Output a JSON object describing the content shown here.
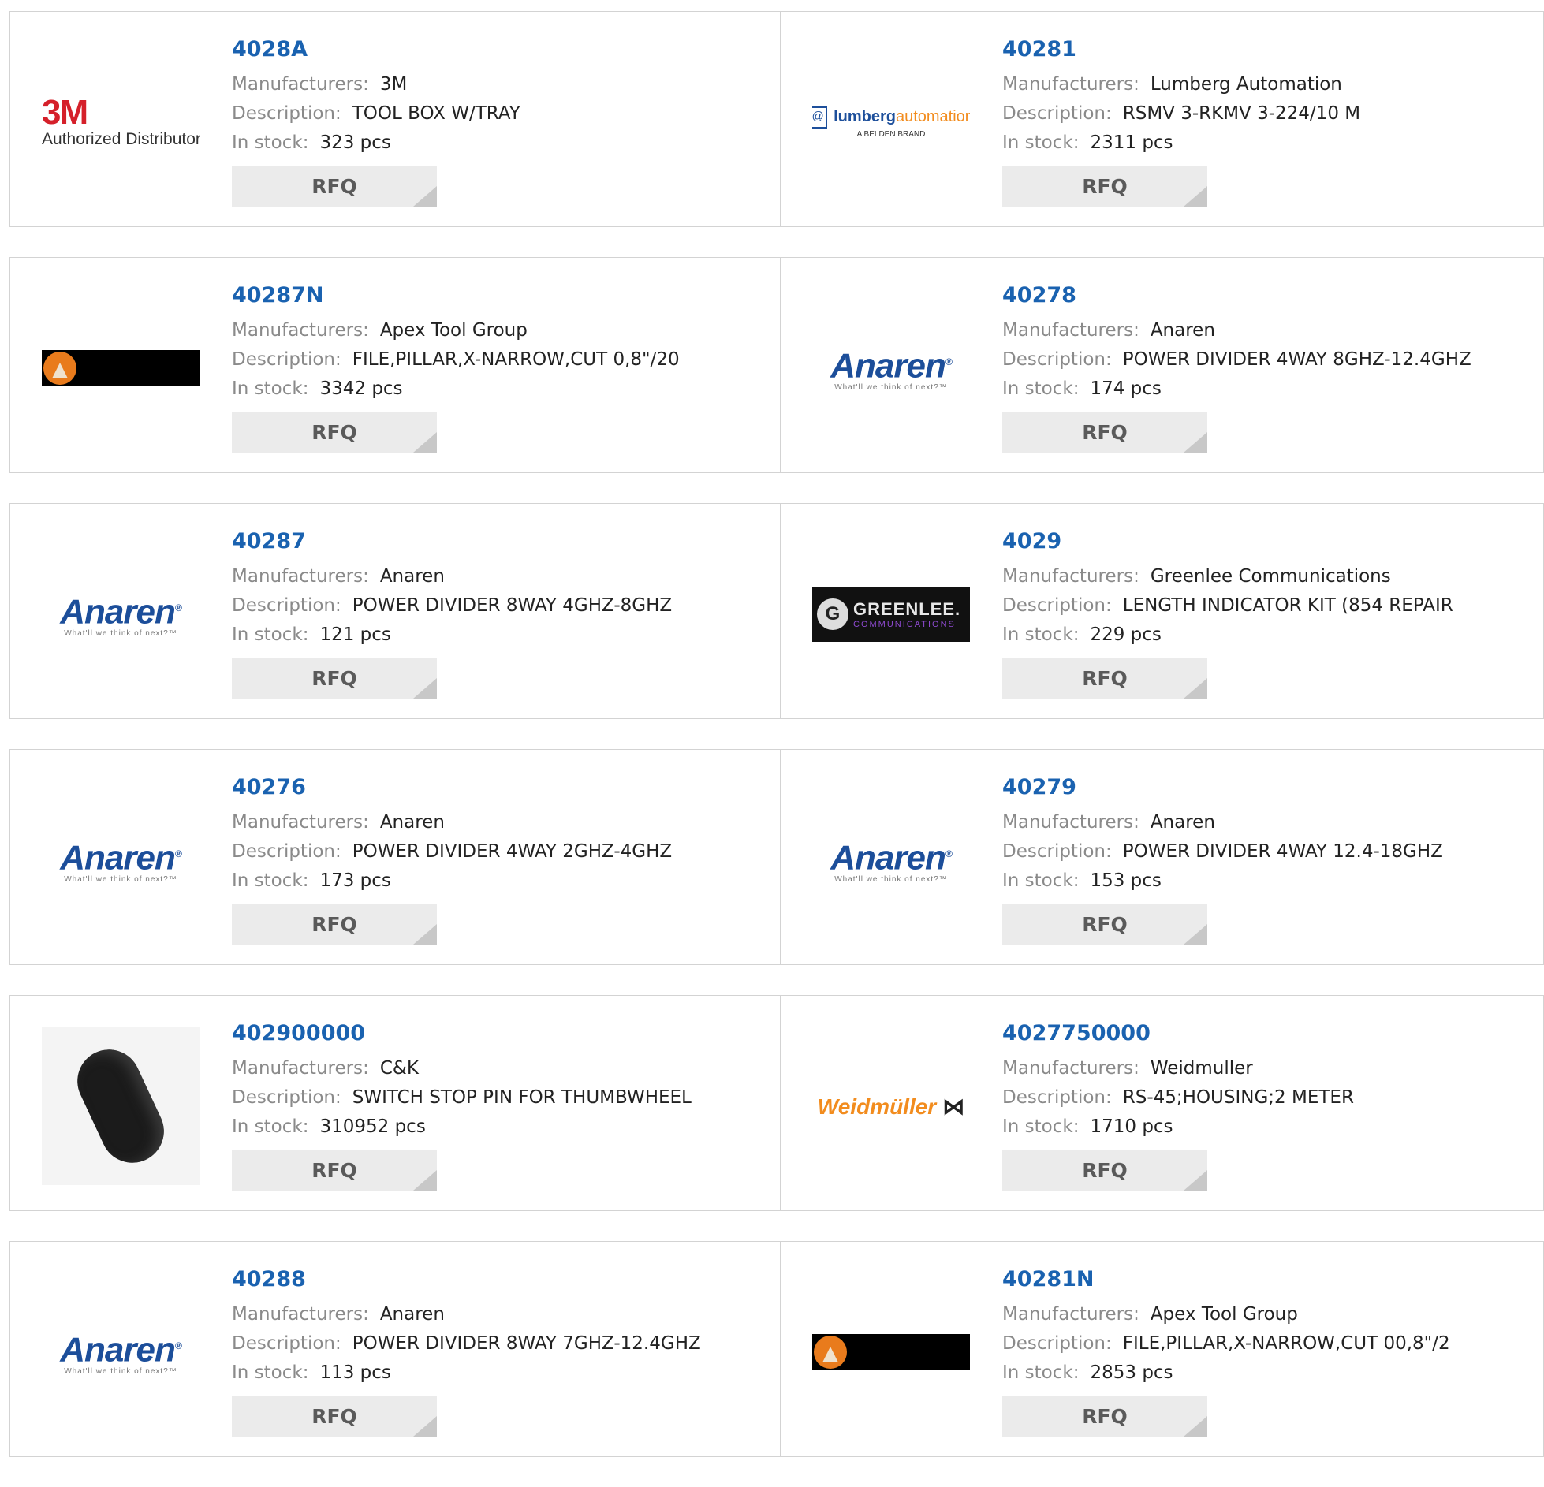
{
  "labels": {
    "manufacturers": "Manufacturers:",
    "description": "Description:",
    "in_stock": "In stock:"
  },
  "rfq_label": "RFQ",
  "logo_text": {
    "threem_big": "3M",
    "threem_small": "Authorized Distributor",
    "lumberg_box": "@",
    "lumberg_word1": "lumberg",
    "lumberg_word2": "automation",
    "lumberg_sub": "A BELDEN BRAND",
    "anaren_name": "Anaren",
    "anaren_reg": "®",
    "anaren_tag": "What'll we think of next?™",
    "greenlee_g": "G",
    "greenlee_name": "GREENLEE.",
    "greenlee_sub": "COMMUNICATIONS",
    "weidmuller_name": "Weidmüller",
    "weidmuller_sym": "⋈"
  },
  "colors": {
    "part_link": "#1a62b0",
    "label": "#8a8a8a",
    "rfq_bg": "#ebebeb",
    "border": "#d3d3d3"
  },
  "products": [
    {
      "part": "4028A",
      "manufacturer": "3M",
      "description": "TOOL BOX W/TRAY",
      "stock": "323 pcs",
      "logo": "3m-logo"
    },
    {
      "part": "40281",
      "manufacturer": "Lumberg Automation",
      "description": "RSMV 3-RKMV 3-224/10 M",
      "stock": "2311 pcs",
      "logo": "lumberg-logo"
    },
    {
      "part": "40287N",
      "manufacturer": "Apex Tool Group",
      "description": "FILE,PILLAR,X-NARROW,CUT 0,8\"/20",
      "stock": "3342 pcs",
      "logo": "apex-logo"
    },
    {
      "part": "40278",
      "manufacturer": "Anaren",
      "description": "POWER DIVIDER 4WAY 8GHZ-12.4GHZ",
      "stock": "174 pcs",
      "logo": "anaren-logo"
    },
    {
      "part": "40287",
      "manufacturer": "Anaren",
      "description": "POWER DIVIDER 8WAY 4GHZ-8GHZ",
      "stock": "121 pcs",
      "logo": "anaren-logo"
    },
    {
      "part": "4029",
      "manufacturer": "Greenlee Communications",
      "description": "LENGTH INDICATOR KIT (854 REPAIR",
      "stock": "229 pcs",
      "logo": "greenlee-logo"
    },
    {
      "part": "40276",
      "manufacturer": "Anaren",
      "description": "POWER DIVIDER 4WAY 2GHZ-4GHZ",
      "stock": "173 pcs",
      "logo": "anaren-logo"
    },
    {
      "part": "40279",
      "manufacturer": "Anaren",
      "description": "POWER DIVIDER 4WAY 12.4-18GHZ",
      "stock": "153 pcs",
      "logo": "anaren-logo"
    },
    {
      "part": "402900000",
      "manufacturer": "C&K",
      "description": "SWITCH STOP PIN FOR THUMBWHEEL",
      "stock": "310952 pcs",
      "logo": "pin-product-image"
    },
    {
      "part": "4027750000",
      "manufacturer": "Weidmuller",
      "description": "RS-45;HOUSING;2 METER",
      "stock": "1710 pcs",
      "logo": "weidmuller-logo"
    },
    {
      "part": "40288",
      "manufacturer": "Anaren",
      "description": "POWER DIVIDER 8WAY 7GHZ-12.4GHZ",
      "stock": "113 pcs",
      "logo": "anaren-logo"
    },
    {
      "part": "40281N",
      "manufacturer": "Apex Tool Group",
      "description": "FILE,PILLAR,X-NARROW,CUT 00,8\"/2",
      "stock": "2853 pcs",
      "logo": "apex-logo"
    }
  ]
}
